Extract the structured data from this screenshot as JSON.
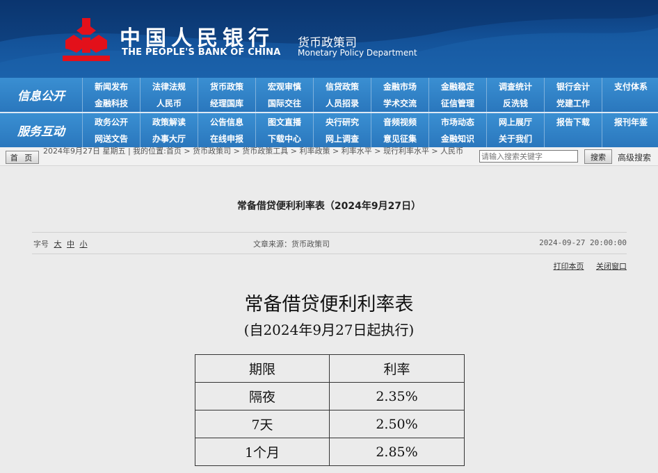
{
  "header": {
    "cn_title": "中国人民银行",
    "en_title": "THE PEOPLE'S BANK OF CHINA",
    "dept_cn": "货币政策司",
    "dept_en": "Monetary Policy Department",
    "logo_icon": "pboc-logo-icon",
    "logo_color": "#e3101a"
  },
  "nav": {
    "sections": [
      {
        "label": "信息公开",
        "items": [
          "新闻发布",
          "法律法规",
          "货币政策",
          "宏观审慎",
          "信贷政策",
          "金融市场",
          "金融稳定",
          "调查统计",
          "银行会计",
          "支付体系",
          "金融科技",
          "人民币",
          "经理国库",
          "国际交往",
          "人员招录",
          "学术交流",
          "征信管理",
          "反洗钱",
          "党建工作",
          ""
        ]
      },
      {
        "label": "服务互动",
        "items": [
          "政务公开",
          "政策解读",
          "公告信息",
          "图文直播",
          "央行研究",
          "音频视频",
          "市场动态",
          "网上展厅",
          "报告下载",
          "报刊年鉴",
          "网送文告",
          "办事大厅",
          "在线申报",
          "下载中心",
          "网上调查",
          "意见征集",
          "金融知识",
          "关于我们",
          "",
          ""
        ]
      }
    ]
  },
  "crumb": {
    "home_label": "首 页",
    "text": "2024年9月27日 星期五 | 我的位置:首页 > 货币政策司 > 货币政策工具 > 利率政策 > 利率水平 > 现行利率水平 > 人民币",
    "search_placeholder": "请输入搜索关键字",
    "search_button": "搜索",
    "advanced_search": "高级搜索"
  },
  "article": {
    "title": "常备借贷便利利率表（2024年9月27日）",
    "font_label": "字号",
    "font_sizes": [
      "大",
      "中",
      "小"
    ],
    "source": "文章来源：货币政策司",
    "datetime": "2024-09-27 20:00:00",
    "print": "打印本页",
    "close": "关闭窗口"
  },
  "doc": {
    "title": "常备借贷便利利率表",
    "subtitle": "(自2024年9月27日起执行)",
    "table": {
      "headers": [
        "期限",
        "利率"
      ],
      "rows": [
        [
          "隔夜",
          "2.35%"
        ],
        [
          "7天",
          "2.50%"
        ],
        [
          "1个月",
          "2.85%"
        ]
      ]
    }
  }
}
